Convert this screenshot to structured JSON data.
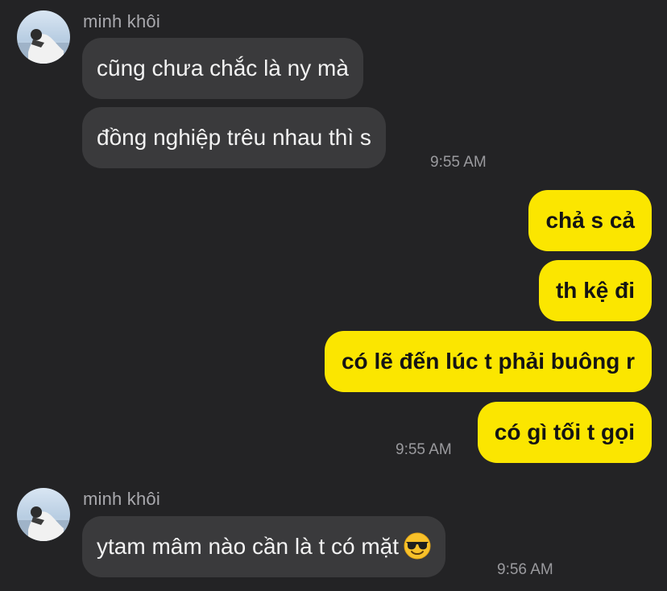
{
  "chat": {
    "groups": [
      {
        "sender": "minh khôi",
        "messages": [
          "cũng chưa chắc là ny mà",
          "đồng nghiệp trêu nhau thì s"
        ],
        "time": "9:55 AM"
      },
      {
        "messages": [
          "chả s cả",
          "th kệ đi",
          "có lẽ đến lúc t phải buông r",
          "có gì tối t gọi"
        ],
        "time": "9:55 AM"
      },
      {
        "sender": "minh khôi",
        "messages": [
          "ytam mâm nào cần là t có mặt"
        ],
        "emoji": "sunglasses-emoji",
        "time": "9:56 AM"
      }
    ]
  },
  "colors": {
    "background": "#232325",
    "incoming_bubble": "#3a3a3c",
    "outgoing_bubble": "#fbe600",
    "sender_text": "#a9a9ae",
    "timestamp_text": "#9a9a9e"
  }
}
